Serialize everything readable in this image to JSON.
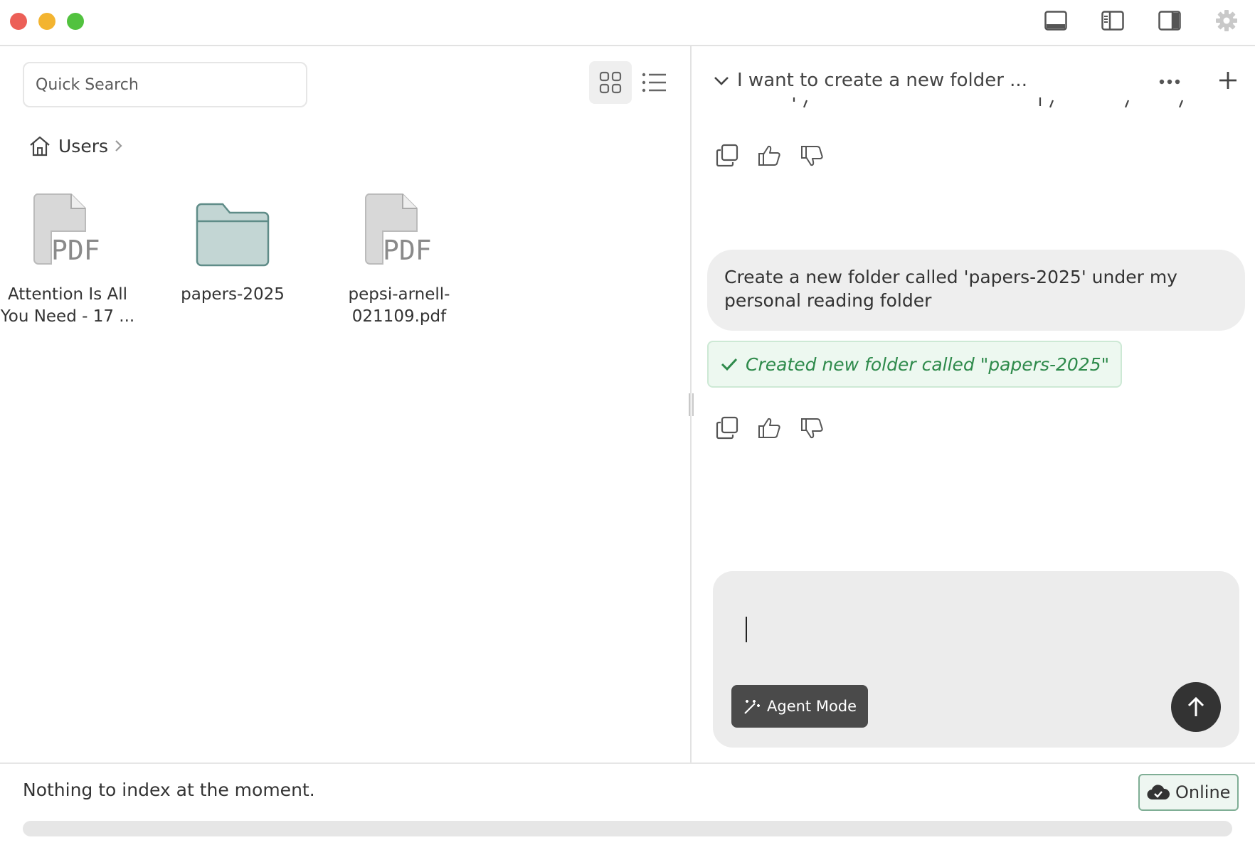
{
  "titlebar": {
    "icons": [
      "layout-bottom-panel-icon",
      "layout-left-sidebar-icon",
      "layout-right-sidebar-icon",
      "gear-icon"
    ]
  },
  "browser": {
    "search": {
      "placeholder": "Quick Search",
      "value": ""
    },
    "view_modes": [
      "grid-view-icon",
      "list-view-icon"
    ],
    "breadcrumb": {
      "home_label": "Users"
    },
    "items": [
      {
        "type": "pdf",
        "name": "Attention Is All You Need - 17 ...",
        "icon_label": "PDF"
      },
      {
        "type": "folder",
        "name": "papers-2025"
      },
      {
        "type": "pdf",
        "name": "pepsi-arnell-021109.pdf",
        "icon_label": "PDF"
      }
    ]
  },
  "chat": {
    "title": "I want to create a new folder ...",
    "messages": [
      {
        "role": "user",
        "text": "Create a new folder called 'papers-2025' under my personal reading folder"
      }
    ],
    "tool_result": "Created new folder called \"papers-2025\"",
    "composer": {
      "value": "",
      "agent_mode_label": "Agent Mode"
    }
  },
  "status": {
    "message": "Nothing to index at the moment.",
    "connection_label": "Online",
    "progress": 0
  },
  "colors": {
    "success_green": "#2e8a4b",
    "folder_fill": "#c3d6d4",
    "folder_stroke": "#5f8c88"
  }
}
